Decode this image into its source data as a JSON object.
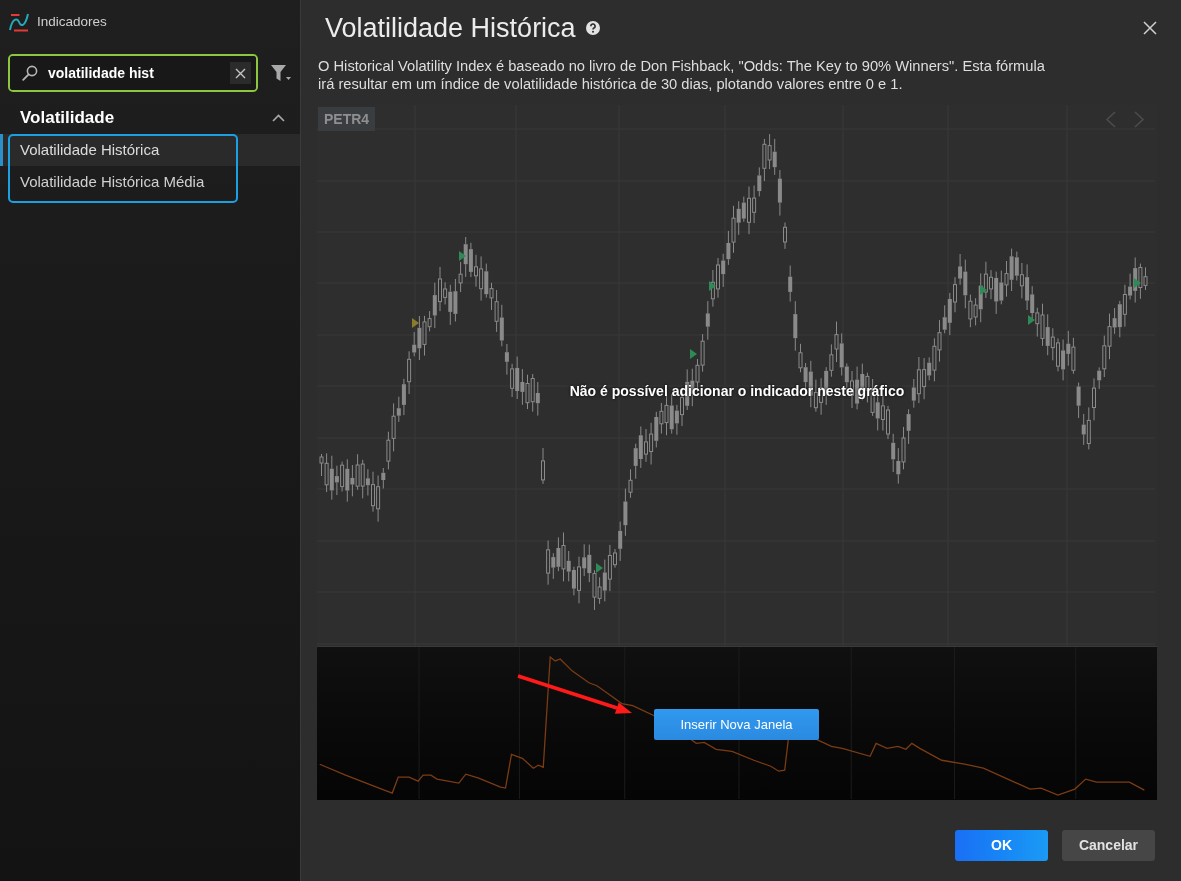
{
  "sidebar": {
    "title": "Indicadores",
    "search": {
      "value": "volatilidade hist",
      "highlight": {
        "color": "#8dc63f"
      }
    },
    "groups": [
      {
        "title": "Volatilidade",
        "expanded": true,
        "highlight": {
          "color": "#1ba1e2"
        },
        "items": [
          {
            "label": "Volatilidade Histórica",
            "selected": true
          },
          {
            "label": "Volatilidade Histórica Média",
            "selected": false
          }
        ]
      }
    ]
  },
  "dialog": {
    "title": "Volatilidade Histórica",
    "description": "O Historical Volatility Index é baseado no livro de Don Fishback, \"Odds: The Key to 90% Winners\". Esta fórmula irá resultar em um índice de volatilidade histórica de 30 dias, plotando valores entre 0 e 1.",
    "preview": {
      "symbol": "PETR4",
      "message": "Não é possível adicionar o indicador neste gráfico",
      "insert_button": "Inserir Nova Janela",
      "pointer_arrow": {
        "color": "#ff1a1a"
      }
    },
    "buttons": [
      {
        "label": "OK",
        "kind": "primary"
      },
      {
        "label": "Cancelar",
        "kind": "secondary"
      }
    ]
  }
}
